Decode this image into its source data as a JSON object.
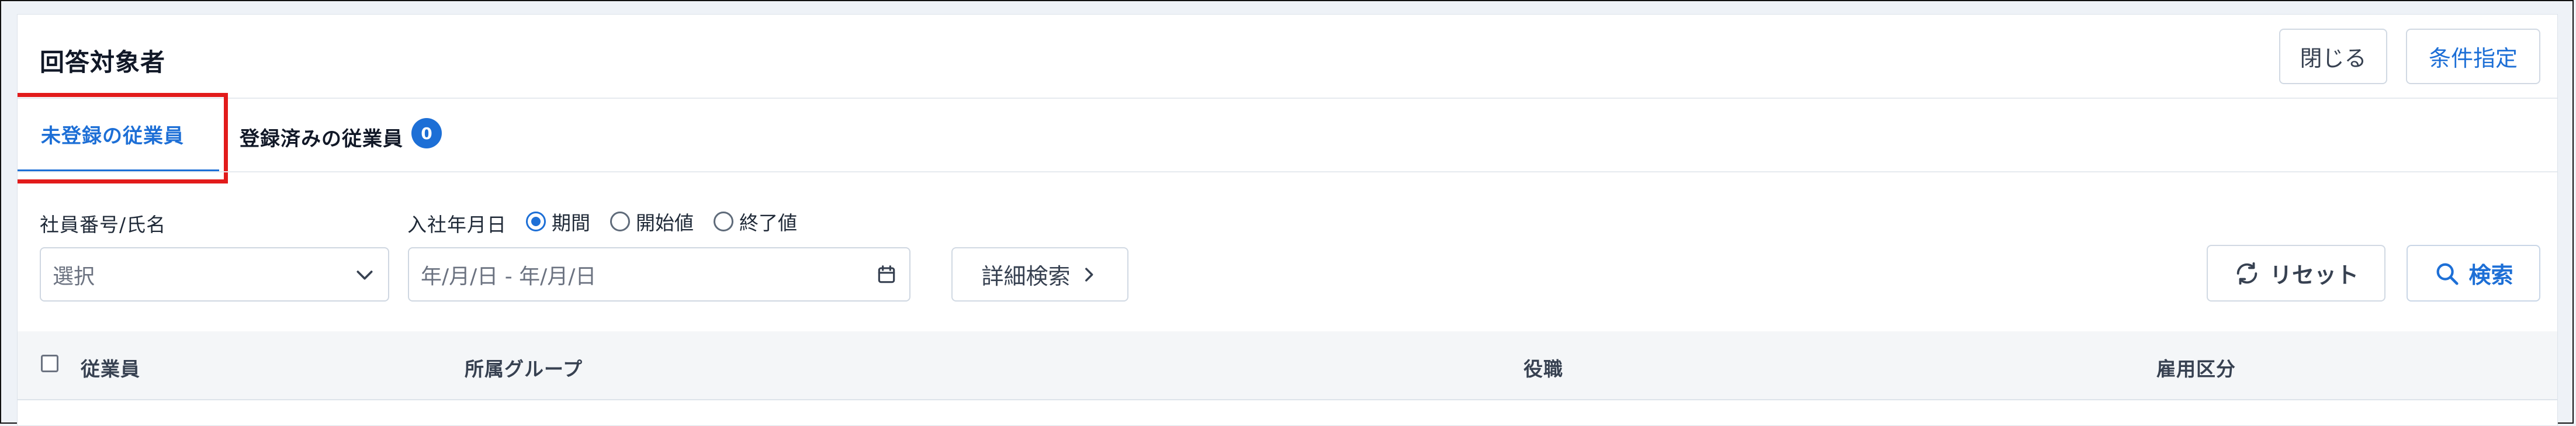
{
  "header": {
    "title": "回答対象者",
    "close_label": "閉じる",
    "conditions_label": "条件指定"
  },
  "tabs": [
    {
      "label": "未登録の従業員",
      "active": true
    },
    {
      "label": "登録済みの従業員",
      "active": false,
      "badge": "0"
    }
  ],
  "filters": {
    "employee_label": "社員番号/氏名",
    "employee_placeholder": "選択",
    "join_date_label": "入社年月日",
    "radios": [
      {
        "label": "期間",
        "checked": true
      },
      {
        "label": "開始値",
        "checked": false
      },
      {
        "label": "終了値",
        "checked": false
      }
    ],
    "date_placeholder": "年/月/日 - 年/月/日",
    "detail_search_label": "詳細検索",
    "reset_label": "リセット",
    "search_label": "検索"
  },
  "table": {
    "columns": [
      "従業員",
      "所属グループ",
      "役職",
      "雇用区分"
    ]
  },
  "colors": {
    "accent": "#1d6fd6",
    "highlight": "#e21b1b"
  }
}
